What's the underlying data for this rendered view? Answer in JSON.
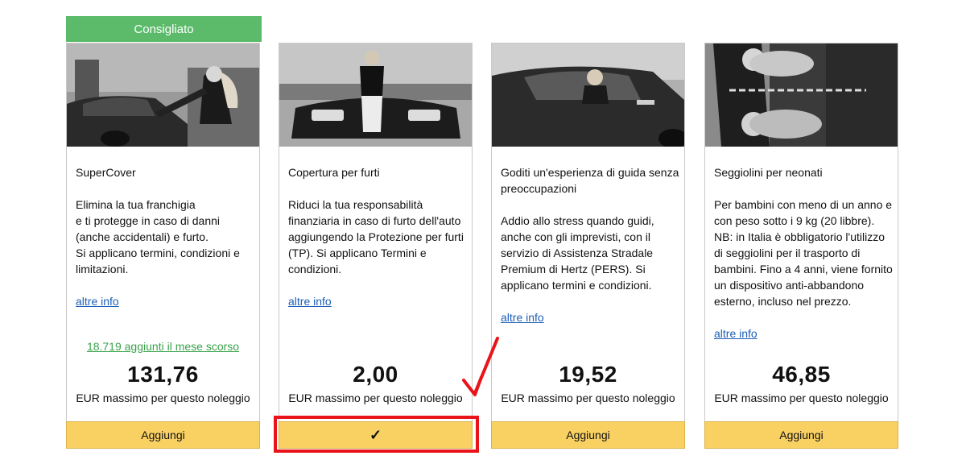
{
  "badge": {
    "label": "Consigliato"
  },
  "cards": [
    {
      "title": "SuperCover",
      "description": "Elimina la tua franchigia\ne ti protegge in caso di danni (anche accidentali) e furto.\nSi applicano termini, condizioni e limitazioni.",
      "more_link": "altre info",
      "social_proof": "18.719 aggiunti il mese scorso",
      "price": "131,76",
      "price_note": "EUR massimo per questo noleggio",
      "button": "Aggiungi"
    },
    {
      "title": "Copertura per furti",
      "description": "Riduci la tua responsabilità finanziaria in caso di furto dell'auto aggiungendo la Protezione per furti (TP). Si applicano Termini e condizioni.",
      "more_link": "altre info",
      "price": "2,00",
      "price_note": "EUR massimo per questo noleggio",
      "button": "✓"
    },
    {
      "title": "Goditi un'esperienza di guida senza preoccupazioni",
      "description": "Addio allo stress quando guidi, anche con gli imprevisti, con il servizio di Assistenza Stradale Premium di Hertz (PERS). Si applicano termini e condizioni.",
      "more_link": "altre info",
      "price": "19,52",
      "price_note": "EUR massimo per questo noleggio",
      "button": "Aggiungi"
    },
    {
      "title": "Seggiolini per neonati",
      "description": "Per bambini con meno di un anno e con peso sotto i 9 kg (20 libbre). NB: in Italia è obbligatorio l'utilizzo di seggiolini per il trasporto di bambini. Fino a 4 anni, viene fornito un dispositivo anti-abbandono esterno, incluso nel prezzo.",
      "more_link": "altre info",
      "price": "46,85",
      "price_note": "EUR massimo per questo noleggio",
      "button": "Aggiungi"
    }
  ],
  "colors": {
    "badge_green": "#5cbb6b",
    "button_yellow": "#f9d163",
    "link_blue": "#1d5fb8",
    "social_green": "#3aa24b",
    "annotation_red": "#e8141a"
  }
}
